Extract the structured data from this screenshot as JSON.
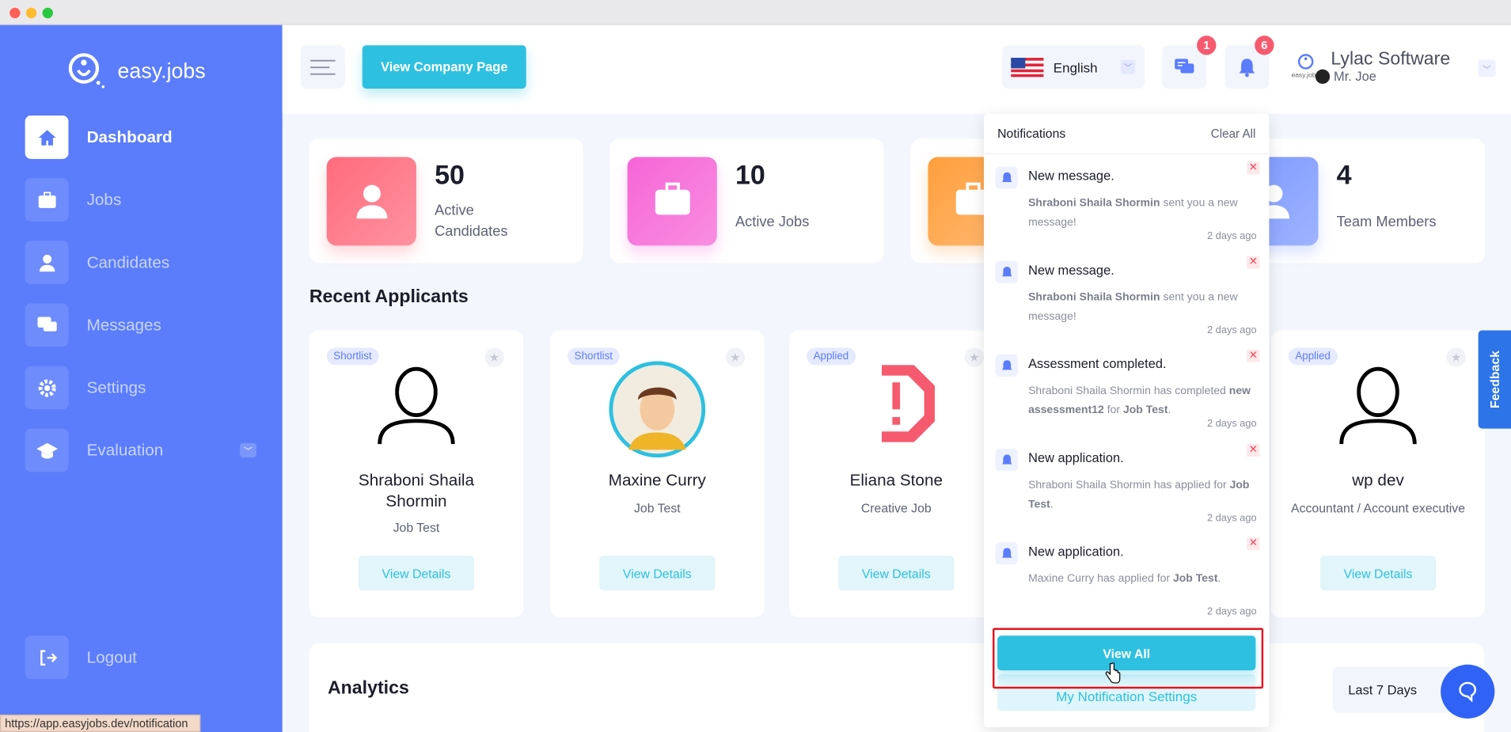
{
  "browser": {
    "status_url": "https://app.easyjobs.dev/notification"
  },
  "brand": {
    "name": "easy.jobs",
    "accent": "#5b7dfb",
    "cyan": "#2ec0e0"
  },
  "sidebar": {
    "items": [
      {
        "label": "Dashboard",
        "icon": "home-icon",
        "active": true
      },
      {
        "label": "Jobs",
        "icon": "briefcase-icon"
      },
      {
        "label": "Candidates",
        "icon": "user-icon"
      },
      {
        "label": "Messages",
        "icon": "chat-icon"
      },
      {
        "label": "Settings",
        "icon": "gear-icon"
      },
      {
        "label": "Evaluation",
        "icon": "graduation-cap-icon",
        "has_submenu": true
      }
    ],
    "logout": "Logout"
  },
  "header": {
    "view_company_page": "View Company Page",
    "language": "English",
    "messages_badge": "1",
    "notifications_badge": "6",
    "company": "Lylac Software",
    "user": "Mr. Joe",
    "logo_text": "easy.jobs"
  },
  "stats": [
    {
      "value": "50",
      "label": "Active Candidates",
      "color": "#ff6b7d"
    },
    {
      "value": "10",
      "label": "Active Jobs",
      "color": "#f665d6"
    },
    {
      "value": "",
      "label": "",
      "color": "#ff9f3d"
    },
    {
      "value": "4",
      "label": "Team Members",
      "color": "#7b98ff"
    }
  ],
  "recent_applicants": {
    "title": "Recent Applicants",
    "view_details": "View Details",
    "items": [
      {
        "tag": "Shortlist",
        "name": "Shraboni Shaila Shormin",
        "job": "Job Test",
        "avatar": "default"
      },
      {
        "tag": "Shortlist",
        "name": "Maxine Curry",
        "job": "Job Test",
        "avatar": "photo"
      },
      {
        "tag": "Applied",
        "name": "Eliana Stone",
        "job": "Creative Job",
        "avatar": "error"
      },
      {
        "tag": "Applied",
        "name": "wp dev",
        "job": "Accountant / Account executive",
        "avatar": "default"
      }
    ]
  },
  "analytics": {
    "title": "Analytics",
    "range": "Last 7 Days"
  },
  "notifications": {
    "title": "Notifications",
    "clear_all": "Clear All",
    "view_all": "View All",
    "settings": "My Notification Settings",
    "items": [
      {
        "title": "New message.",
        "parts": [
          {
            "b": "Shraboni Shaila Shormin"
          },
          {
            "t": " sent you a new message!"
          }
        ],
        "time": "2 days ago"
      },
      {
        "title": "New message.",
        "parts": [
          {
            "b": "Shraboni Shaila Shormin"
          },
          {
            "t": " sent you a new message!"
          }
        ],
        "time": "2 days ago"
      },
      {
        "title": "Assessment completed.",
        "parts": [
          {
            "t": "Shraboni Shaila Shormin has completed "
          },
          {
            "b": "new assessment12"
          },
          {
            "t": " for "
          },
          {
            "b": "Job Test"
          },
          {
            "t": "."
          }
        ],
        "time": "2 days ago"
      },
      {
        "title": "New application.",
        "parts": [
          {
            "t": "Shraboni Shaila Shormin has applied for "
          },
          {
            "b": "Job Test"
          },
          {
            "t": "."
          }
        ],
        "time": "2 days ago"
      },
      {
        "title": "New application.",
        "parts": [
          {
            "t": "Maxine Curry has applied for "
          },
          {
            "b": "Job Test"
          },
          {
            "t": "."
          }
        ],
        "time": "2 days ago"
      }
    ]
  },
  "feedback": "Feedback"
}
